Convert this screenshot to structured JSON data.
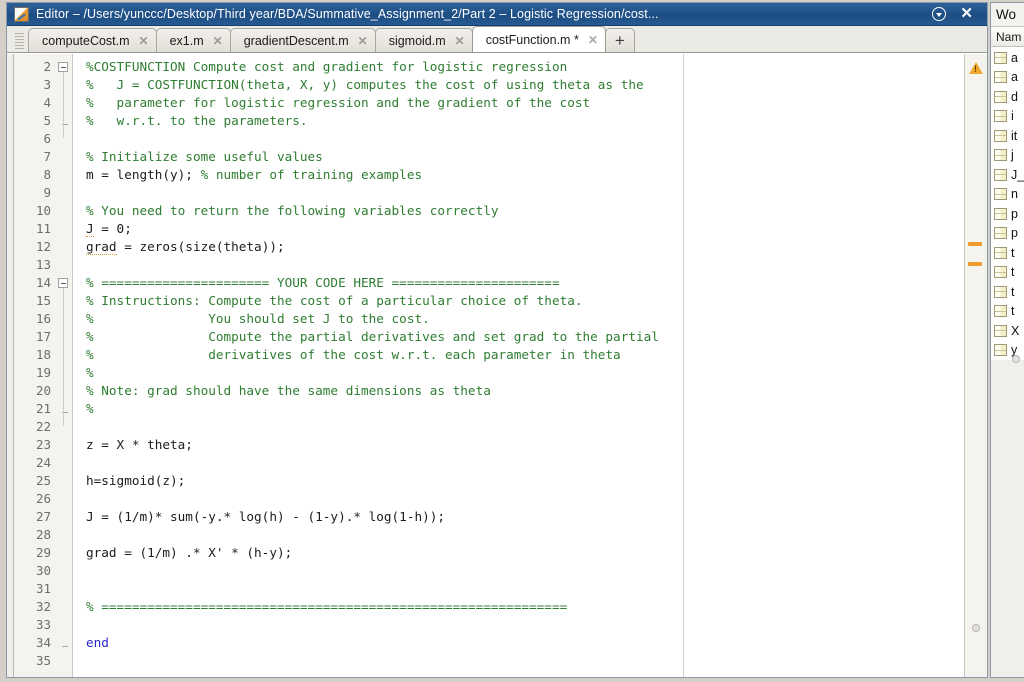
{
  "window": {
    "title": "Editor – /Users/yunccc/Desktop/Third year/BDA/Summative_Assignment_2/Part 2 – Logistic Regression/cost...",
    "icon": "matlab-editor-icon",
    "dropdown_label": "▼",
    "close_label": "✕"
  },
  "tabs": {
    "items": [
      {
        "label": "computeCost.m",
        "active": false,
        "modified": false,
        "close": "✕"
      },
      {
        "label": "ex1.m",
        "active": false,
        "modified": false,
        "close": "✕"
      },
      {
        "label": "gradientDescent.m",
        "active": false,
        "modified": false,
        "close": "✕"
      },
      {
        "label": "sigmoid.m",
        "active": false,
        "modified": false,
        "close": "✕"
      },
      {
        "label": "costFunction.m *",
        "active": true,
        "modified": true,
        "close": "✕"
      }
    ],
    "add_label": "+"
  },
  "editor": {
    "first_line": 2,
    "last_line": 35,
    "line_numbers": [
      "2",
      "3",
      "4",
      "5",
      "6",
      "7",
      "8",
      "9",
      "10",
      "11",
      "12",
      "13",
      "14",
      "15",
      "16",
      "17",
      "18",
      "19",
      "20",
      "21",
      "22",
      "23",
      "24",
      "25",
      "26",
      "27",
      "28",
      "29",
      "30",
      "31",
      "32",
      "33",
      "34",
      "35"
    ],
    "lines": [
      {
        "n": "2",
        "text": "%COSTFUNCTION Compute cost and gradient for logistic regression",
        "style": "comment",
        "fold": "open"
      },
      {
        "n": "3",
        "text": "%   J = COSTFUNCTION(theta, X, y) computes the cost of using theta as the",
        "style": "comment"
      },
      {
        "n": "4",
        "text": "%   parameter for logistic regression and the gradient of the cost",
        "style": "comment"
      },
      {
        "n": "5",
        "text": "%   w.r.t. to the parameters.",
        "style": "comment",
        "fold": "end"
      },
      {
        "n": "6",
        "text": "",
        "style": "plain"
      },
      {
        "n": "7",
        "text": "% Initialize some useful values",
        "style": "comment"
      },
      {
        "n": "8",
        "text": "m = length(y); % number of training examples",
        "style": "mixed",
        "code": "m = length(y); ",
        "comment": "% number of training examples"
      },
      {
        "n": "9",
        "text": "",
        "style": "plain"
      },
      {
        "n": "10",
        "text": "% You need to return the following variables correctly",
        "style": "comment"
      },
      {
        "n": "11",
        "text": "J = 0;",
        "style": "plain",
        "warn_token": "J"
      },
      {
        "n": "12",
        "text": "grad = zeros(size(theta));",
        "style": "plain",
        "warn_token": "grad"
      },
      {
        "n": "13",
        "text": "",
        "style": "plain"
      },
      {
        "n": "14",
        "text": "% ====================== YOUR CODE HERE ======================",
        "style": "comment",
        "fold": "open"
      },
      {
        "n": "15",
        "text": "% Instructions: Compute the cost of a particular choice of theta.",
        "style": "comment"
      },
      {
        "n": "16",
        "text": "%               You should set J to the cost.",
        "style": "comment"
      },
      {
        "n": "17",
        "text": "%               Compute the partial derivatives and set grad to the partial",
        "style": "comment"
      },
      {
        "n": "18",
        "text": "%               derivatives of the cost w.r.t. each parameter in theta",
        "style": "comment"
      },
      {
        "n": "19",
        "text": "%",
        "style": "comment"
      },
      {
        "n": "20",
        "text": "% Note: grad should have the same dimensions as theta",
        "style": "comment"
      },
      {
        "n": "21",
        "text": "%",
        "style": "comment",
        "fold": "end"
      },
      {
        "n": "22",
        "text": "",
        "style": "plain"
      },
      {
        "n": "23",
        "text": "z = X * theta;",
        "style": "plain"
      },
      {
        "n": "24",
        "text": "",
        "style": "plain"
      },
      {
        "n": "25",
        "text": "h=sigmoid(z);",
        "style": "plain"
      },
      {
        "n": "26",
        "text": "",
        "style": "plain"
      },
      {
        "n": "27",
        "text": "J = (1/m)* sum(-y.* log(h) - (1-y).* log(1-h));",
        "style": "plain"
      },
      {
        "n": "28",
        "text": "",
        "style": "plain"
      },
      {
        "n": "29",
        "text": "grad = (1/m) .* X' * (h-y);",
        "style": "plain"
      },
      {
        "n": "30",
        "text": "",
        "style": "plain"
      },
      {
        "n": "31",
        "text": "",
        "style": "plain"
      },
      {
        "n": "32",
        "text": "% =============================================================",
        "style": "comment"
      },
      {
        "n": "33",
        "text": "",
        "style": "plain"
      },
      {
        "n": "34",
        "text": "end",
        "style": "keyword",
        "fold": "end"
      },
      {
        "n": "35",
        "text": "",
        "style": "plain"
      }
    ],
    "annotations": {
      "warning_icon": "warning-triangle",
      "markers": [
        "warning-marker",
        "warning-marker"
      ]
    }
  },
  "workspace": {
    "title": "Wo",
    "column_header": "Nam",
    "variables": [
      "a",
      "a",
      "d",
      "i",
      "it",
      "j",
      "J_",
      "n",
      "p",
      "p",
      "t",
      "t",
      "t",
      "t",
      "X",
      "y"
    ]
  },
  "colors": {
    "titlebar": "#21538a",
    "comment": "#2f7d32",
    "keyword": "#2b2bcc",
    "warning": "#ef9a2a",
    "code_bg": "#ffffff"
  }
}
